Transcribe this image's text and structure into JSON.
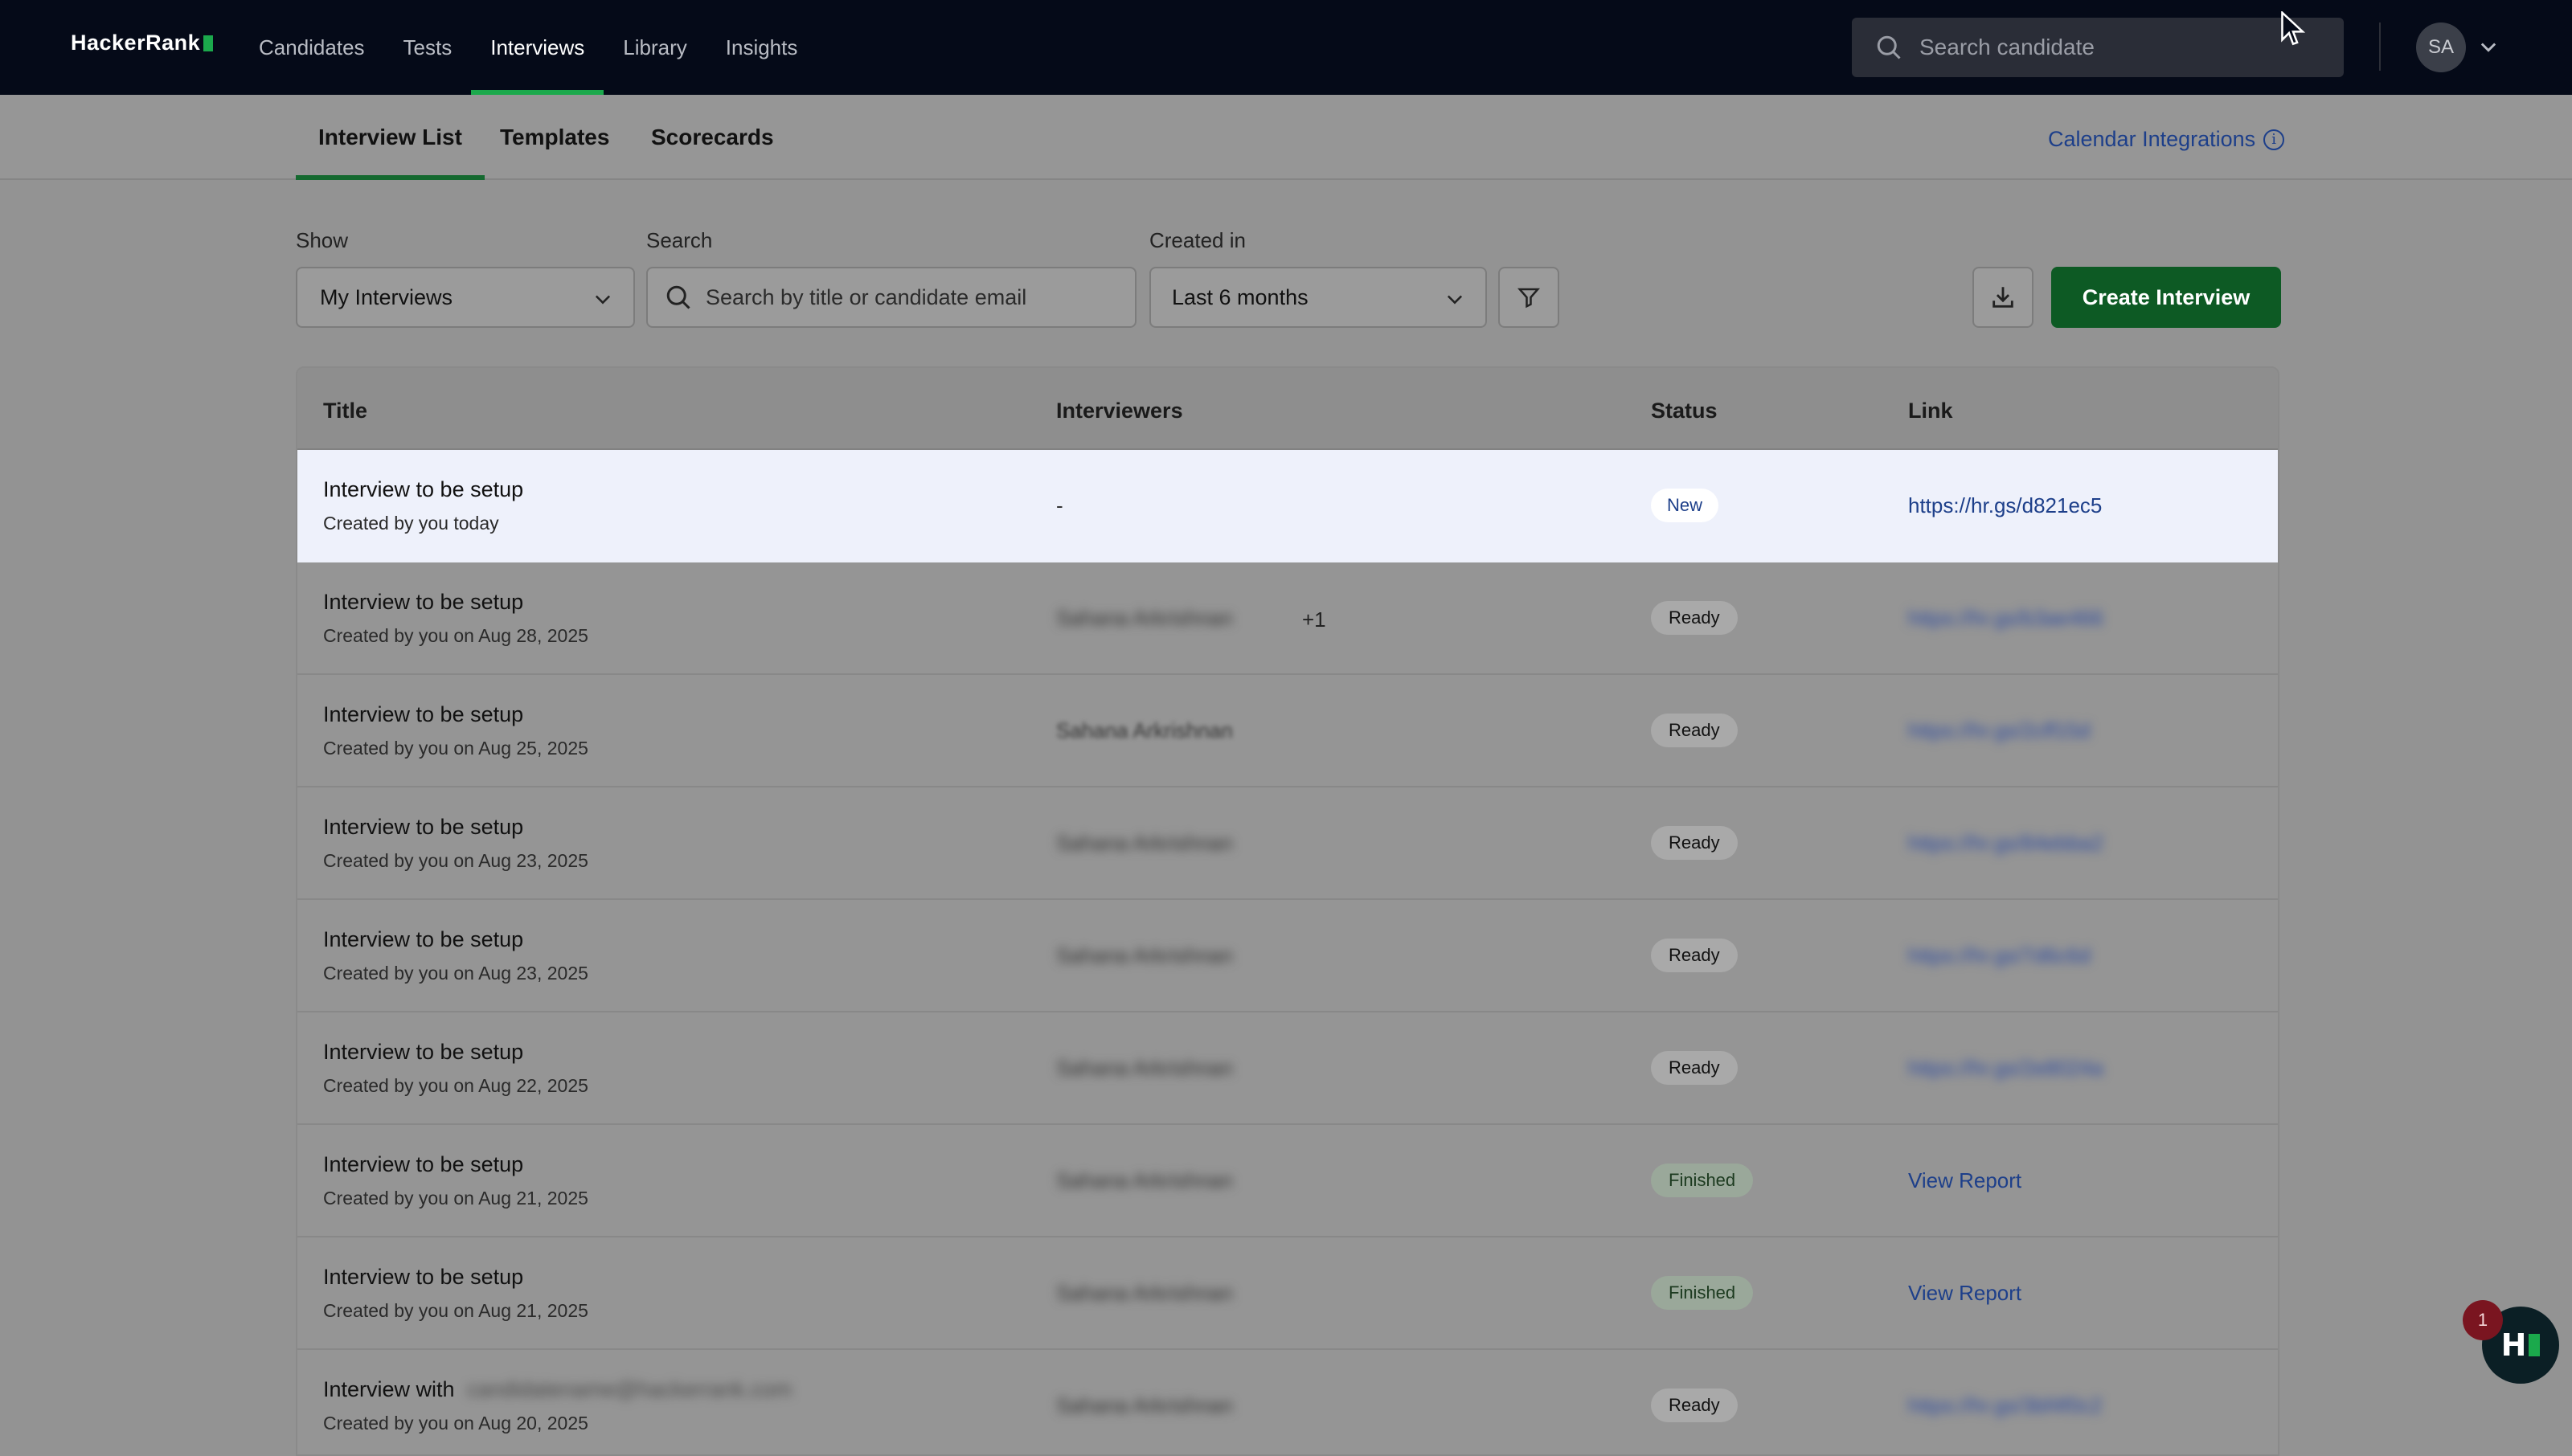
{
  "topnav": {
    "logo_text": "HackerRank",
    "links": [
      {
        "label": "Candidates"
      },
      {
        "label": "Tests"
      },
      {
        "label": "Interviews"
      },
      {
        "label": "Library"
      },
      {
        "label": "Insights"
      }
    ],
    "active_link": "Interviews",
    "search_placeholder": "Search candidate",
    "avatar_initials": "SA"
  },
  "subtabs": {
    "items": [
      {
        "label": "Interview List"
      },
      {
        "label": "Templates"
      },
      {
        "label": "Scorecards"
      }
    ],
    "active": "Interview List",
    "calendar_integrations_label": "Calendar Integrations"
  },
  "filters": {
    "show_label": "Show",
    "show_value": "My Interviews",
    "search_label": "Search",
    "search_placeholder": "Search by title or candidate email",
    "created_label": "Created in",
    "created_value": "Last 6 months",
    "create_button_label": "Create Interview"
  },
  "table": {
    "columns": [
      "Title",
      "Interviewers",
      "Status",
      "Link"
    ],
    "rows": [
      {
        "title": "Interview to be setup",
        "subtitle": "Created by you today",
        "interviewers": "-",
        "extra": "",
        "status": "New",
        "link": "https://hr.gs/d821ec5"
      },
      {
        "title": "Interview to be setup",
        "subtitle": "Created by you on Aug 28, 2025",
        "interviewers": "Sahana Arkrishnan",
        "extra": "+1",
        "status": "Ready",
        "link": "https://hr.gs/b3ae466"
      },
      {
        "title": "Interview to be setup",
        "subtitle": "Created by you on Aug 25, 2025",
        "interviewers": "Sahana Arkrishnan",
        "extra": "",
        "status": "Ready",
        "link": "https://hr.gs/2cff15d"
      },
      {
        "title": "Interview to be setup",
        "subtitle": "Created by you on Aug 23, 2025",
        "interviewers": "Sahana Arkrishnan",
        "extra": "",
        "status": "Ready",
        "link": "https://hr.gs/84ebba2"
      },
      {
        "title": "Interview to be setup",
        "subtitle": "Created by you on Aug 23, 2025",
        "interviewers": "Sahana Arkrishnan",
        "extra": "",
        "status": "Ready",
        "link": "https://hr.gs/7d6c6d"
      },
      {
        "title": "Interview to be setup",
        "subtitle": "Created by you on Aug 22, 2025",
        "interviewers": "Sahana Arkrishnan",
        "extra": "",
        "status": "Ready",
        "link": "https://hr.gs/2e8024a"
      },
      {
        "title": "Interview to be setup",
        "subtitle": "Created by you on Aug 21, 2025",
        "interviewers": "Sahana Arkrishnan",
        "extra": "",
        "status": "Finished",
        "link": "View Report"
      },
      {
        "title": "Interview to be setup",
        "subtitle": "Created by you on Aug 21, 2025",
        "interviewers": "Sahana Arkrishnan",
        "extra": "",
        "status": "Finished",
        "link": "View Report"
      },
      {
        "title": "Interview with",
        "title_suffix": "candidatename@hackerrank.com",
        "subtitle": "Created by you on Aug 20, 2025",
        "interviewers": "Sahana Arkrishnan",
        "extra": "",
        "status": "Ready",
        "link": "https://hr.gs/3bf4f0c2"
      }
    ]
  },
  "help_widget": {
    "notification_count": "1",
    "logo_letter": "H"
  },
  "colors": {
    "nav_bg": "#050a18",
    "accent_green": "#1ba94c",
    "button_green": "#0d5a24",
    "link_blue": "#1d3f8a"
  }
}
